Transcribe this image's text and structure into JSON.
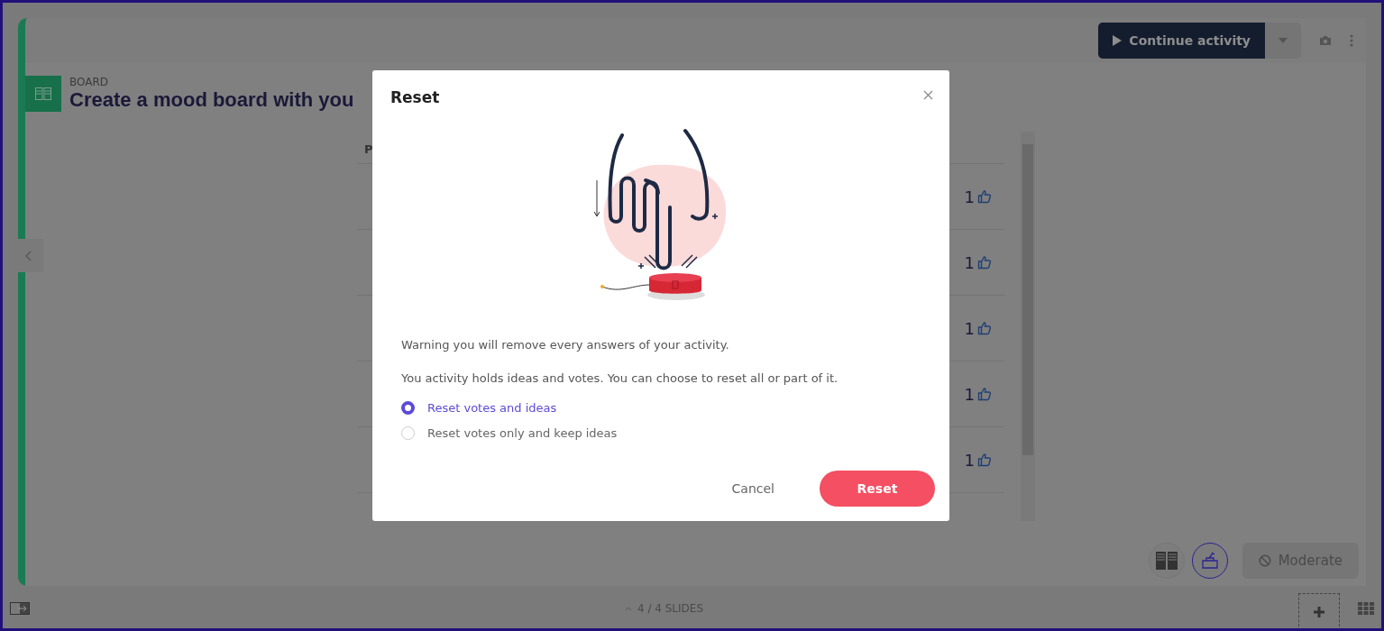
{
  "header": {
    "continue_button": "Continue activity"
  },
  "activity": {
    "type_label": "BOARD",
    "title": "Create a mood board with you"
  },
  "board": {
    "column_header": "P",
    "rows": [
      {
        "votes": "1"
      },
      {
        "votes": "1"
      },
      {
        "votes": "1"
      },
      {
        "votes": "1"
      },
      {
        "votes": "1"
      }
    ]
  },
  "tools": {
    "moderate_button": "Moderate"
  },
  "footer": {
    "slides_counter": "4 / 4 SLIDES"
  },
  "dialog": {
    "title": "Reset",
    "warning": "Warning you will remove every answers of your activity.",
    "description": "You activity holds ideas and votes. You can choose to reset all or part of it.",
    "options": [
      {
        "label": "Reset votes and ideas",
        "selected": true
      },
      {
        "label": "Reset votes only and keep ideas",
        "selected": false
      }
    ],
    "buttons": [
      {
        "label": "Cancel",
        "kind": "secondary"
      },
      {
        "label": "Reset",
        "kind": "primary"
      }
    ]
  }
}
